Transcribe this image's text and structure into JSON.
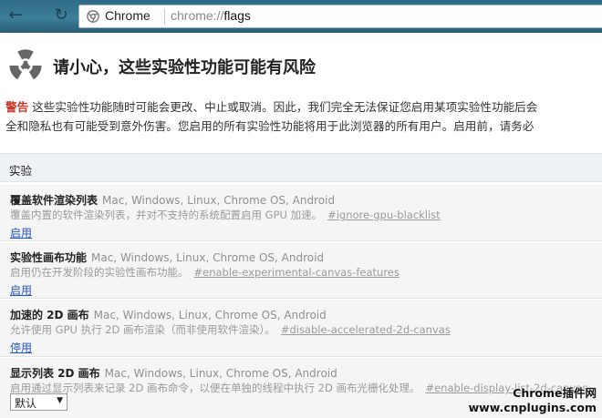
{
  "browser": {
    "omnibox": {
      "chip_label": "Chrome",
      "url_scheme": "chrome://",
      "url_path": "flags"
    }
  },
  "warning": {
    "title": "请小心，这些实验性功能可能有风险",
    "label": "警告",
    "line1": "这些实验性功能随时可能会更改、中止或取消。因此，我们完全无法保证您启用某项实验性功能后会",
    "line2": "全和隐私也有可能受到意外伤害。您启用的所有实验性功能将用于此浏览器的所有用户。启用前，请务必"
  },
  "experiments_header": "实验",
  "experiments": [
    {
      "name": "覆盖软件渲染列表",
      "platforms": "Mac, Windows, Linux, Chrome OS, Android",
      "description": "覆盖内置的软件渲染列表，并对不支持的系统配置启用 GPU 加速。",
      "permalink": "#ignore-gpu-blacklist",
      "action": "启用"
    },
    {
      "name": "实验性画布功能",
      "platforms": "Mac, Windows, Linux, Chrome OS, Android",
      "description": "启用仍在开发阶段的实验性画布功能。",
      "permalink": "#enable-experimental-canvas-features",
      "action": "启用"
    },
    {
      "name": "加速的 2D 画布",
      "platforms": "Mac, Windows, Linux, Chrome OS, Android",
      "description": "允许使用 GPU 执行 2D 画布渲染（而非使用软件渲染）。",
      "permalink": "#disable-accelerated-2d-canvas",
      "action": "停用"
    },
    {
      "name": "显示列表 2D 画布",
      "platforms": "Mac, Windows, Linux, Chrome OS, Android",
      "description": "启用通过显示列表来记录 2D 画布命令，以便在单独的线程中执行 2D 画布光栅化处理。",
      "permalink": "#enable-display-list-2d-canvas",
      "select_value": "默认"
    }
  ],
  "watermark": {
    "line1": "Chrome插件网",
    "line2": "www.cnplugins.com"
  },
  "colors": {
    "warning_label": "#c53929",
    "link": "#2255bb",
    "toolbar": "#3d7f99"
  },
  "icons": [
    "back-arrow-icon",
    "reload-icon",
    "chrome-logo-icon",
    "radiation-hazard-icon",
    "dropdown-arrow-icon"
  ]
}
